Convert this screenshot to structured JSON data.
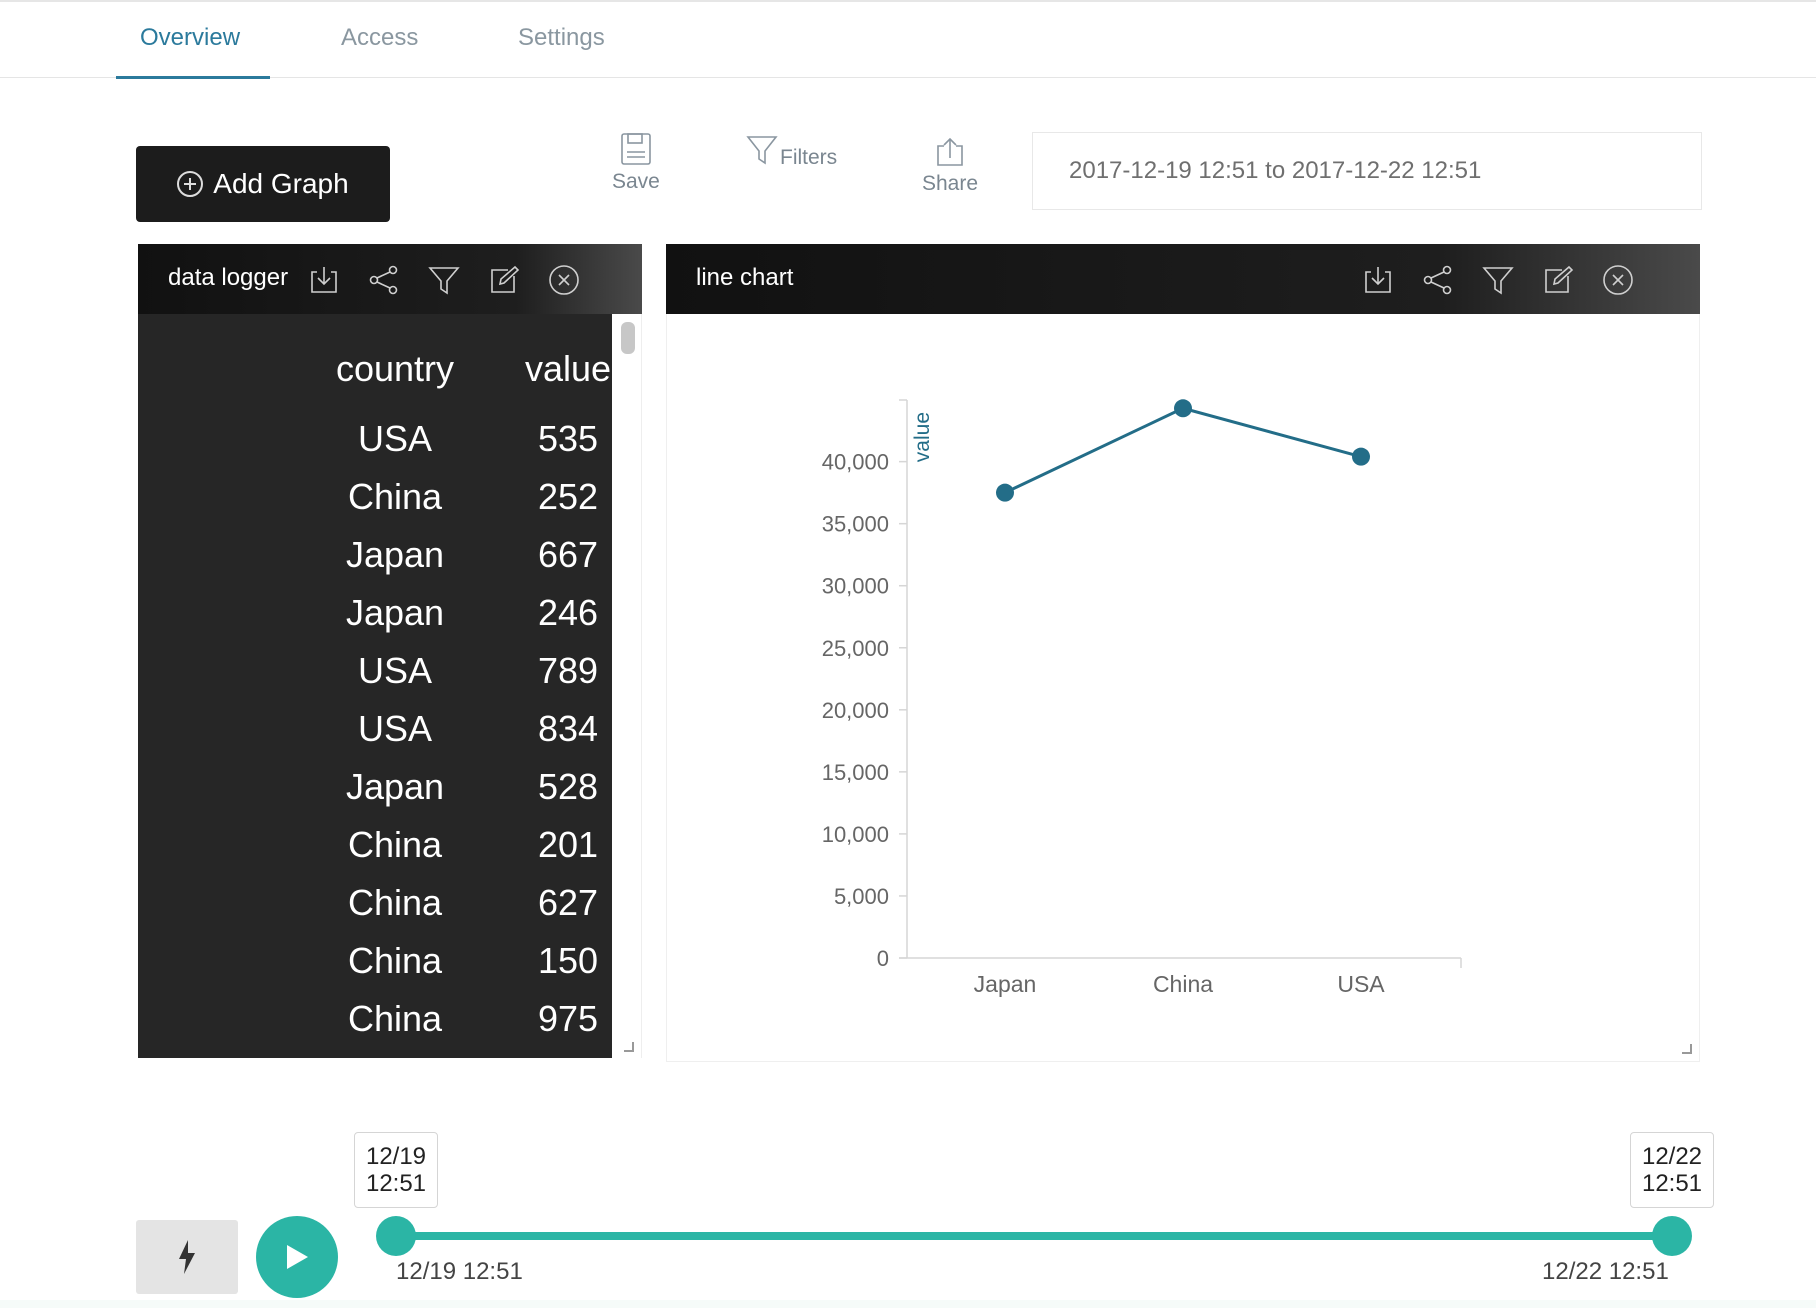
{
  "tabs": [
    {
      "label": "Overview",
      "active": true
    },
    {
      "label": "Access",
      "active": false
    },
    {
      "label": "Settings",
      "active": false
    }
  ],
  "toolbar": {
    "add_graph_label": "Add Graph",
    "save_label": "Save",
    "filters_label": "Filters",
    "share_label": "Share",
    "date_range": "2017-12-19 12:51 to 2017-12-22 12:51"
  },
  "logger": {
    "title": "data logger",
    "columns": [
      "country",
      "value"
    ],
    "rows": [
      [
        "USA",
        "535"
      ],
      [
        "China",
        "252"
      ],
      [
        "Japan",
        "667"
      ],
      [
        "Japan",
        "246"
      ],
      [
        "USA",
        "789"
      ],
      [
        "USA",
        "834"
      ],
      [
        "Japan",
        "528"
      ],
      [
        "China",
        "201"
      ],
      [
        "China",
        "627"
      ],
      [
        "China",
        "150"
      ],
      [
        "China",
        "975"
      ]
    ]
  },
  "chart_panel": {
    "title": "line chart"
  },
  "chart_data": {
    "type": "line",
    "title": "",
    "xlabel": "",
    "ylabel": "value",
    "categories": [
      "Japan",
      "China",
      "USA"
    ],
    "series": [
      {
        "values": [
          37500,
          44300,
          40400
        ]
      }
    ],
    "ylim": [
      0,
      44000
    ],
    "yticks": [
      0,
      5000,
      10000,
      15000,
      20000,
      25000,
      30000,
      35000,
      40000
    ],
    "ytick_labels": [
      "0",
      "5,000",
      "10,000",
      "15,000",
      "20,000",
      "25,000",
      "30,000",
      "35,000",
      "40,000"
    ],
    "line_color": "#236d88",
    "grid": false
  },
  "timeline": {
    "start_tip_date": "12/19",
    "start_tip_time": "12:51",
    "end_tip_date": "12/22",
    "end_tip_time": "12:51",
    "start_label": "12/19 12:51",
    "end_label": "12/22 12:51",
    "accent": "#2bb5a5"
  },
  "colors": {
    "accent": "#2b7a9c",
    "panel_dark": "#262626"
  }
}
